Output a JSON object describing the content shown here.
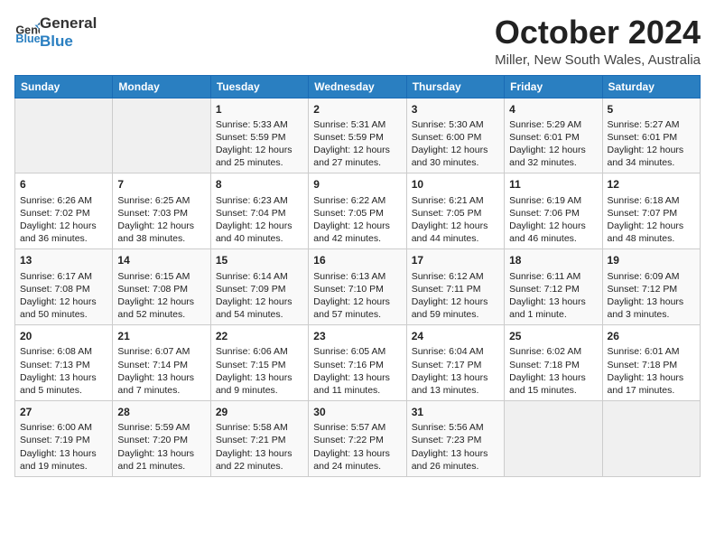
{
  "header": {
    "logo_line1": "General",
    "logo_line2": "Blue",
    "title": "October 2024",
    "subtitle": "Miller, New South Wales, Australia"
  },
  "weekdays": [
    "Sunday",
    "Monday",
    "Tuesday",
    "Wednesday",
    "Thursday",
    "Friday",
    "Saturday"
  ],
  "weeks": [
    [
      {
        "day": "",
        "content": ""
      },
      {
        "day": "",
        "content": ""
      },
      {
        "day": "1",
        "content": "Sunrise: 5:33 AM\nSunset: 5:59 PM\nDaylight: 12 hours\nand 25 minutes."
      },
      {
        "day": "2",
        "content": "Sunrise: 5:31 AM\nSunset: 5:59 PM\nDaylight: 12 hours\nand 27 minutes."
      },
      {
        "day": "3",
        "content": "Sunrise: 5:30 AM\nSunset: 6:00 PM\nDaylight: 12 hours\nand 30 minutes."
      },
      {
        "day": "4",
        "content": "Sunrise: 5:29 AM\nSunset: 6:01 PM\nDaylight: 12 hours\nand 32 minutes."
      },
      {
        "day": "5",
        "content": "Sunrise: 5:27 AM\nSunset: 6:01 PM\nDaylight: 12 hours\nand 34 minutes."
      }
    ],
    [
      {
        "day": "6",
        "content": "Sunrise: 6:26 AM\nSunset: 7:02 PM\nDaylight: 12 hours\nand 36 minutes."
      },
      {
        "day": "7",
        "content": "Sunrise: 6:25 AM\nSunset: 7:03 PM\nDaylight: 12 hours\nand 38 minutes."
      },
      {
        "day": "8",
        "content": "Sunrise: 6:23 AM\nSunset: 7:04 PM\nDaylight: 12 hours\nand 40 minutes."
      },
      {
        "day": "9",
        "content": "Sunrise: 6:22 AM\nSunset: 7:05 PM\nDaylight: 12 hours\nand 42 minutes."
      },
      {
        "day": "10",
        "content": "Sunrise: 6:21 AM\nSunset: 7:05 PM\nDaylight: 12 hours\nand 44 minutes."
      },
      {
        "day": "11",
        "content": "Sunrise: 6:19 AM\nSunset: 7:06 PM\nDaylight: 12 hours\nand 46 minutes."
      },
      {
        "day": "12",
        "content": "Sunrise: 6:18 AM\nSunset: 7:07 PM\nDaylight: 12 hours\nand 48 minutes."
      }
    ],
    [
      {
        "day": "13",
        "content": "Sunrise: 6:17 AM\nSunset: 7:08 PM\nDaylight: 12 hours\nand 50 minutes."
      },
      {
        "day": "14",
        "content": "Sunrise: 6:15 AM\nSunset: 7:08 PM\nDaylight: 12 hours\nand 52 minutes."
      },
      {
        "day": "15",
        "content": "Sunrise: 6:14 AM\nSunset: 7:09 PM\nDaylight: 12 hours\nand 54 minutes."
      },
      {
        "day": "16",
        "content": "Sunrise: 6:13 AM\nSunset: 7:10 PM\nDaylight: 12 hours\nand 57 minutes."
      },
      {
        "day": "17",
        "content": "Sunrise: 6:12 AM\nSunset: 7:11 PM\nDaylight: 12 hours\nand 59 minutes."
      },
      {
        "day": "18",
        "content": "Sunrise: 6:11 AM\nSunset: 7:12 PM\nDaylight: 13 hours\nand 1 minute."
      },
      {
        "day": "19",
        "content": "Sunrise: 6:09 AM\nSunset: 7:12 PM\nDaylight: 13 hours\nand 3 minutes."
      }
    ],
    [
      {
        "day": "20",
        "content": "Sunrise: 6:08 AM\nSunset: 7:13 PM\nDaylight: 13 hours\nand 5 minutes."
      },
      {
        "day": "21",
        "content": "Sunrise: 6:07 AM\nSunset: 7:14 PM\nDaylight: 13 hours\nand 7 minutes."
      },
      {
        "day": "22",
        "content": "Sunrise: 6:06 AM\nSunset: 7:15 PM\nDaylight: 13 hours\nand 9 minutes."
      },
      {
        "day": "23",
        "content": "Sunrise: 6:05 AM\nSunset: 7:16 PM\nDaylight: 13 hours\nand 11 minutes."
      },
      {
        "day": "24",
        "content": "Sunrise: 6:04 AM\nSunset: 7:17 PM\nDaylight: 13 hours\nand 13 minutes."
      },
      {
        "day": "25",
        "content": "Sunrise: 6:02 AM\nSunset: 7:18 PM\nDaylight: 13 hours\nand 15 minutes."
      },
      {
        "day": "26",
        "content": "Sunrise: 6:01 AM\nSunset: 7:18 PM\nDaylight: 13 hours\nand 17 minutes."
      }
    ],
    [
      {
        "day": "27",
        "content": "Sunrise: 6:00 AM\nSunset: 7:19 PM\nDaylight: 13 hours\nand 19 minutes."
      },
      {
        "day": "28",
        "content": "Sunrise: 5:59 AM\nSunset: 7:20 PM\nDaylight: 13 hours\nand 21 minutes."
      },
      {
        "day": "29",
        "content": "Sunrise: 5:58 AM\nSunset: 7:21 PM\nDaylight: 13 hours\nand 22 minutes."
      },
      {
        "day": "30",
        "content": "Sunrise: 5:57 AM\nSunset: 7:22 PM\nDaylight: 13 hours\nand 24 minutes."
      },
      {
        "day": "31",
        "content": "Sunrise: 5:56 AM\nSunset: 7:23 PM\nDaylight: 13 hours\nand 26 minutes."
      },
      {
        "day": "",
        "content": ""
      },
      {
        "day": "",
        "content": ""
      }
    ]
  ]
}
